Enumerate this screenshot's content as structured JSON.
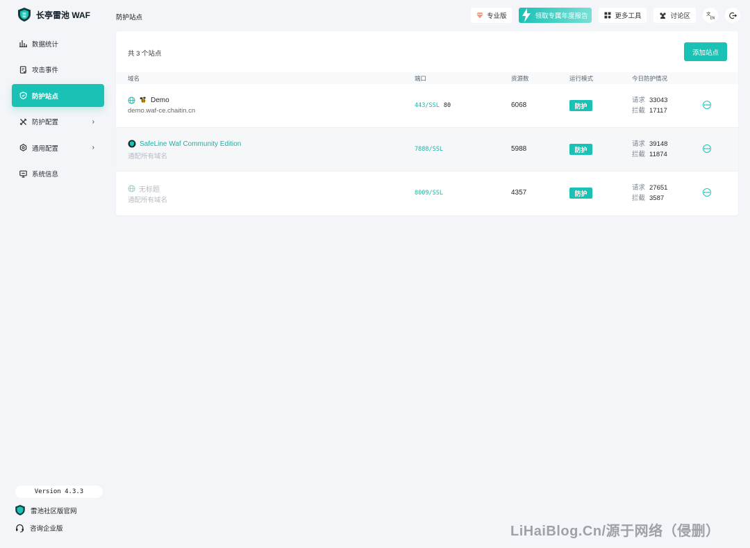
{
  "brand": {
    "name": "长亭雷池 WAF"
  },
  "sidebar": {
    "items": [
      {
        "label": "数据统计",
        "icon": "bar-chart-icon",
        "active": false,
        "has_children": false
      },
      {
        "label": "攻击事件",
        "icon": "document-check-icon",
        "active": false,
        "has_children": false
      },
      {
        "label": "防护站点",
        "icon": "shield-icon",
        "active": true,
        "has_children": false
      },
      {
        "label": "防护配置",
        "icon": "tools-icon",
        "active": false,
        "has_children": true
      },
      {
        "label": "通用配置",
        "icon": "gear-icon",
        "active": false,
        "has_children": true
      },
      {
        "label": "系统信息",
        "icon": "monitor-icon",
        "active": false,
        "has_children": false
      }
    ],
    "version": "Version 4.3.3",
    "footer_links": [
      {
        "label": "雷池社区版官网",
        "icon": "safeline-logo-icon"
      },
      {
        "label": "咨询企业版",
        "icon": "headset-icon"
      }
    ]
  },
  "header": {
    "page_title": "防护站点",
    "actions": {
      "pro": "专业版",
      "promo": "领取专属年度报告",
      "tools": "更多工具",
      "forum": "讨论区"
    }
  },
  "main": {
    "count_label": "共 3 个站点",
    "add_button": "添加站点",
    "columns": {
      "domain": "域名",
      "port": "端口",
      "resources": "资源数",
      "mode": "运行模式",
      "today": "今日防护情况"
    },
    "stat_labels": {
      "requests": "请求",
      "blocked": "拦截"
    },
    "rows": [
      {
        "title": "Demo",
        "subtitle": "demo.waf-ce.chaitin.cn",
        "ports_ssl": "443/SSL",
        "ports_plain": "80",
        "resources": "6068",
        "mode": "防护",
        "requests": "33043",
        "blocked": "17117"
      },
      {
        "title": "SafeLine Waf Community Edition",
        "subtitle": "通配所有域名",
        "ports_ssl": "7888/SSL",
        "ports_plain": "",
        "resources": "5988",
        "mode": "防护",
        "requests": "39148",
        "blocked": "11874"
      },
      {
        "title": "无标题",
        "subtitle": "通配所有域名",
        "ports_ssl": "8009/SSL",
        "ports_plain": "",
        "resources": "4357",
        "mode": "防护",
        "requests": "27651",
        "blocked": "3587"
      }
    ]
  },
  "watermark": "LiHaiBlog.Cn/源于网络（侵删）",
  "colors": {
    "accent": "#19c2b4",
    "background": "#f3f5f8"
  }
}
